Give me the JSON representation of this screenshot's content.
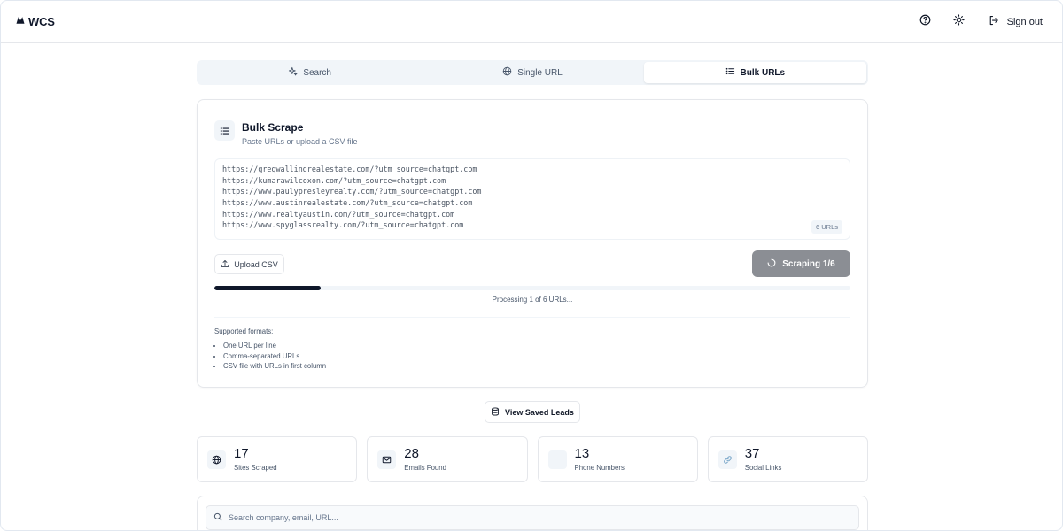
{
  "brand": {
    "name": "WCS"
  },
  "header": {
    "help_icon": "help-circle-icon",
    "theme_icon": "sun-icon",
    "signout_label": "Sign out"
  },
  "tabs": [
    {
      "label": "Search",
      "icon": "sparkles-icon",
      "active": false
    },
    {
      "label": "Single URL",
      "icon": "globe-icon",
      "active": false
    },
    {
      "label": "Bulk URLs",
      "icon": "list-icon",
      "active": true
    }
  ],
  "bulk": {
    "title": "Bulk Scrape",
    "subtitle": "Paste URLs or upload a CSV file",
    "urls": [
      "https://gregwallingrealestate.com/?utm_source=chatgpt.com",
      "https://kumarawilcoxon.com/?utm_source=chatgpt.com",
      "https://www.paulypresleyrealty.com/?utm_source=chatgpt.com",
      "https://www.austinrealestate.com/?utm_source=chatgpt.com",
      "https://www.realtyaustin.com/?utm_source=chatgpt.com",
      "https://www.spyglassrealty.com/?utm_source=chatgpt.com"
    ],
    "url_count": "6 URLs",
    "upload_label": "Upload CSV",
    "scrape_label": "Scraping 1/6",
    "progress": 0.167,
    "progress_text": "Processing 1 of 6 URLs...",
    "formats_title": "Supported formats:",
    "formats": [
      "One URL per line",
      "Comma-separated URLs",
      "CSV file with URLs in first column"
    ]
  },
  "saved_leads_label": "View Saved Leads",
  "stats": [
    {
      "value": "17",
      "label": "Sites Scraped",
      "icon": "globe-icon"
    },
    {
      "value": "28",
      "label": "Emails Found",
      "icon": "mail-icon"
    },
    {
      "value": "13",
      "label": "Phone Numbers",
      "icon": "phone-icon"
    },
    {
      "value": "37",
      "label": "Social Links",
      "icon": "link-icon"
    }
  ],
  "search": {
    "placeholder": "Search company, email, URL..."
  },
  "colors": {
    "primary": "#0f172a",
    "muted_button": "#8b8e94",
    "border": "#e5e7eb",
    "muted_bg": "#f1f5f9"
  }
}
